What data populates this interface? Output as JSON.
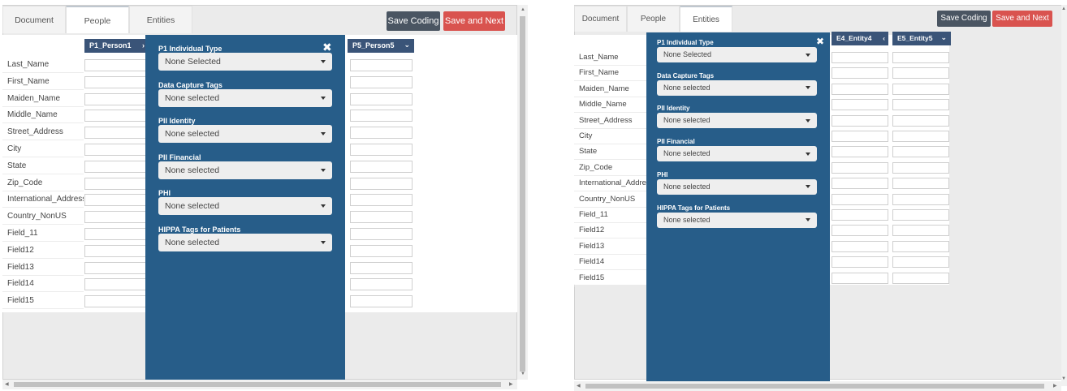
{
  "colors": {
    "panel": "#275d89",
    "header": "#3a5478",
    "save_coding": "#4a5562",
    "save_next": "#d9534f"
  },
  "left": {
    "tabs": [
      "Document",
      "People",
      "Entities"
    ],
    "active_tab": "People",
    "buttons": {
      "save_coding": "Save Coding",
      "save_next": "Save and Next"
    },
    "columns": {
      "first": "P1_Person1",
      "last": "P5_Person5"
    },
    "rows": [
      "Last_Name",
      "First_Name",
      "Maiden_Name",
      "Middle_Name",
      "Street_Address",
      "City",
      "State",
      "Zip_Code",
      "International_Address",
      "Country_NonUS",
      "Field_11",
      "Field12",
      "Field13",
      "Field14",
      "Field15"
    ],
    "panel": {
      "fields": [
        {
          "title": "P1 Individual Type",
          "value": "None Selected"
        },
        {
          "title": "Data Capture Tags",
          "value": "None selected"
        },
        {
          "title": "PII Identity",
          "value": "None selected"
        },
        {
          "title": "PII Financial",
          "value": "None selected"
        },
        {
          "title": "PHI",
          "value": "None selected"
        },
        {
          "title": "HIPPA Tags for Patients",
          "value": "None selected"
        }
      ]
    }
  },
  "right": {
    "tabs": [
      "Document",
      "People",
      "Entities"
    ],
    "active_tab": "Entities",
    "buttons": {
      "save_coding": "Save Coding",
      "save_next": "Save and Next"
    },
    "columns": {
      "first": "E4_Entity4",
      "last": "E5_Entity5"
    },
    "rows": [
      "Last_Name",
      "First_Name",
      "Maiden_Name",
      "Middle_Name",
      "Street_Address",
      "City",
      "State",
      "Zip_Code",
      "International_Address",
      "Country_NonUS",
      "Field_11",
      "Field12",
      "Field13",
      "Field14",
      "Field15"
    ],
    "panel": {
      "fields": [
        {
          "title": "P1 Individual Type",
          "value": "None Selected"
        },
        {
          "title": "Data Capture Tags",
          "value": "None selected"
        },
        {
          "title": "PII Identity",
          "value": "None selected"
        },
        {
          "title": "PII Financial",
          "value": "None selected"
        },
        {
          "title": "PHI",
          "value": "None selected"
        },
        {
          "title": "HIPPA Tags for Patients",
          "value": "None selected"
        }
      ]
    }
  }
}
